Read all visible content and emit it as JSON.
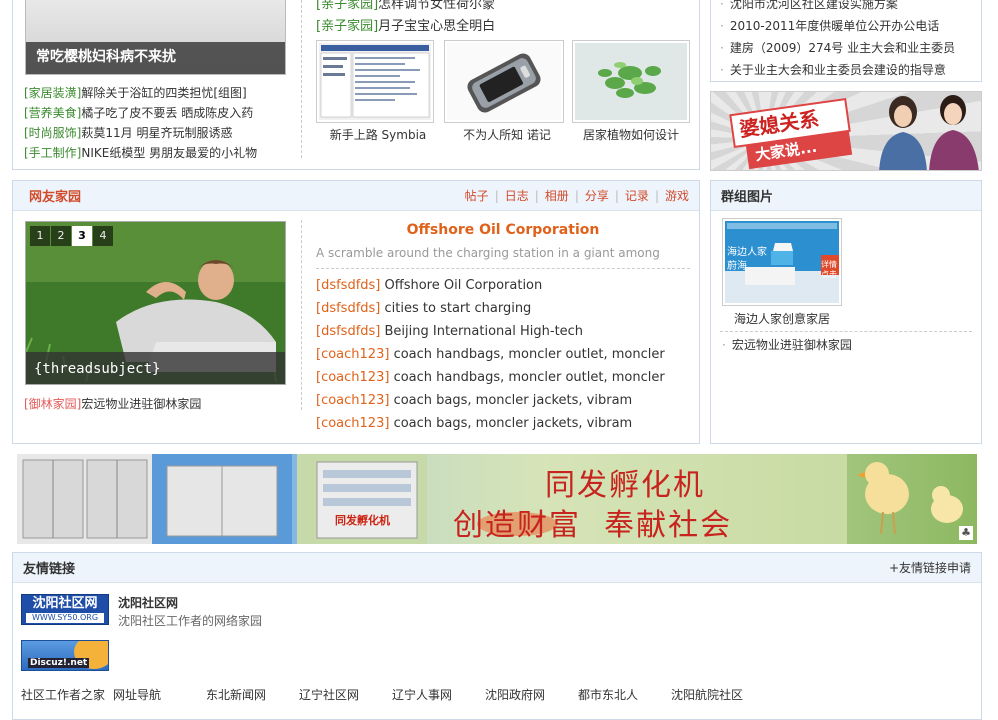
{
  "top": {
    "feature_caption": "常吃樱桃妇科病不来扰",
    "left_list": [
      {
        "cat": "[家居装潢]",
        "text": "解除关于浴缸的四类担忧[组图]"
      },
      {
        "cat": "[营养美食]",
        "text": "橘子吃了皮不要丢 晒成陈皮入药"
      },
      {
        "cat": "[时尚服饰]",
        "text": "萩莫11月 明星齐玩制服诱惑"
      },
      {
        "cat": "[手工制作]",
        "text": "NIKE纸模型 男朋友最爱的小礼物"
      }
    ],
    "mid_list": [
      {
        "cat": "[亲子家园]",
        "text": "怎样调节女性荷尔蒙"
      },
      {
        "cat": "[亲子家园]",
        "text": "月子宝宝心思全明白"
      }
    ],
    "thumbs": [
      {
        "caption": "新手上路 Symbia"
      },
      {
        "caption": "不为人所知 诺记"
      },
      {
        "caption": "居家植物如何设计"
      }
    ],
    "right_list": [
      "沈阳市沈河区社区建设实施方案",
      "2010-2011年度供暖单位公开办公电话",
      "建房（2009）274号 业主大会和业主委员",
      "关于业主大会和业主委员会建设的指导意"
    ],
    "ad_text": {
      "line1": "婆媳关系",
      "line2": "大家说..."
    }
  },
  "community": {
    "title": "网友家园",
    "nav": [
      "帖子",
      "日志",
      "相册",
      "分享",
      "记录",
      "游戏"
    ],
    "slider_pages": [
      "1",
      "2",
      "3",
      "4"
    ],
    "slider_active": "3",
    "slider_caption": "{threadsubject}",
    "under_slider": {
      "cat": "[御林家园]",
      "text": "宏远物业进驻御林家园"
    },
    "headline": "Offshore Oil Corporation",
    "subline": "A scramble around the charging station in a giant among",
    "posts": [
      {
        "author": "[dsfsdfds]",
        "text": "Offshore Oil Corporation"
      },
      {
        "author": "[dsfsdfds]",
        "text": "cities to start charging"
      },
      {
        "author": "[dsfsdfds]",
        "text": "Beijing International High-tech"
      },
      {
        "author": "[coach123]",
        "text": "coach handbags, moncler outlet, moncler"
      },
      {
        "author": "[coach123]",
        "text": "coach handbags, moncler outlet, moncler"
      },
      {
        "author": "[coach123]",
        "text": "coach bags, moncler jackets, vibram"
      },
      {
        "author": "[coach123]",
        "text": "coach bags, moncler jackets, vibram"
      }
    ]
  },
  "group": {
    "title": "群组图片",
    "thumb_text": {
      "a": "海边人家",
      "b": "蔚海",
      "c": "详情",
      "d": "点击"
    },
    "thumb_caption": "海边人家创意家居",
    "list": [
      "宏远物业进驻御林家园"
    ]
  },
  "banner": {
    "title": "同发孵化机",
    "slogan": "创造财富  奉献社会",
    "machine_label": "同发孵化机"
  },
  "links": {
    "title": "友情链接",
    "apply": "+友情链接申请",
    "featured": {
      "logo_text": "沈阳社区网",
      "logo_sub": "WWW.SY50.ORG",
      "name": "沈阳社区网",
      "desc": "沈阳社区工作者的网络家园"
    },
    "discuz_logo": "Discuz!.net",
    "text_links": [
      "社区工作者之家",
      "网址导航",
      "东北新闻网",
      "辽宁社区网",
      "辽宁人事网",
      "沈阳政府网",
      "都市东北人",
      "沈阳航院社区"
    ]
  },
  "colors": {
    "accent_red": "#d14b2b",
    "cat_green": "#3a8a2e",
    "cat_orange": "#e0621a",
    "header_bg": "#eef4fb",
    "border": "#cdd9e6"
  }
}
